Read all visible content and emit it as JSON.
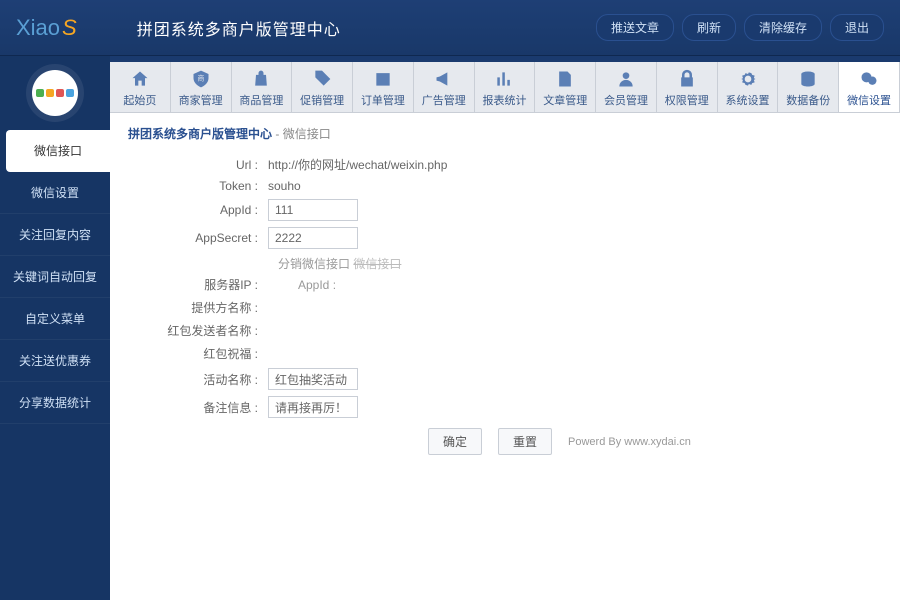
{
  "header": {
    "logo_main": "Xiao",
    "logo_accent": "S",
    "title": "拼团系统多商户版管理中心",
    "actions": [
      "推送文章",
      "刷新",
      "清除缓存",
      "退出"
    ]
  },
  "sidebar": {
    "items": [
      "微信接口",
      "微信设置",
      "关注回复内容",
      "关键词自动回复",
      "自定义菜单",
      "关注送优惠券",
      "分享数据统计"
    ],
    "active_index": 0
  },
  "tabs": {
    "items": [
      "起始页",
      "商家管理",
      "商品管理",
      "促销管理",
      "订单管理",
      "广告管理",
      "报表统计",
      "文章管理",
      "会员管理",
      "权限管理",
      "系统设置",
      "数据备份",
      "微信设置"
    ],
    "active_index": 12
  },
  "breadcrumb": {
    "main": "拼团系统多商户版管理中心",
    "sub": "- 微信接口"
  },
  "form": {
    "url_label": "Url :",
    "url_value": "http://你的网址/wechat/weixin.php",
    "token_label": "Token :",
    "token_value": "souho",
    "appid_label": "AppId :",
    "appid_value": "111",
    "appsecret_label": "AppSecret :",
    "appsecret_value": "2222",
    "sep_text": "分销微信接口",
    "sep_strike": "微信接口",
    "server_ip_label": "服务器IP :",
    "server_extra": "AppId :",
    "provider_label": "提供方名称 :",
    "sender_label": "红包发送者名称 :",
    "blessing_label": "红包祝福 :",
    "activity_label": "活动名称 :",
    "activity_value": "红包抽奖活动",
    "remark_label": "备注信息 :",
    "remark_value": "请再接再厉！",
    "submit": "确定",
    "reset": "重置",
    "powered": "Powerd By www.xydai.cn"
  }
}
